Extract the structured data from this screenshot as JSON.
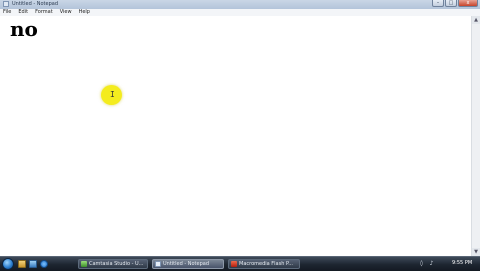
{
  "window": {
    "title": "Untitled - Notepad",
    "controls": {
      "minimize": "–",
      "maximize": "□",
      "close": "x"
    }
  },
  "menu": {
    "items": [
      {
        "label": "File"
      },
      {
        "label": "Edit"
      },
      {
        "label": "Format"
      },
      {
        "label": "View"
      },
      {
        "label": "Help"
      }
    ]
  },
  "editor": {
    "text": "no",
    "cursor_glyph": "I"
  },
  "scrollbar": {
    "up": "▲",
    "down": "▼"
  },
  "taskbar": {
    "quick_launch": [
      "explorer-icon",
      "desktop-icon",
      "browser-icon"
    ],
    "tasks": [
      {
        "label": "Camtasia Studio - U..."
      },
      {
        "label": "Untitled - Notepad"
      },
      {
        "label": "Macromedia Flash P..."
      }
    ],
    "tray": {
      "volume": "♪",
      "network": "◊"
    },
    "clock": "9:55 PM"
  },
  "colors": {
    "highlight": "#f4ec1e",
    "taskbar": "#1d2530",
    "start": "#2c7fd0"
  }
}
